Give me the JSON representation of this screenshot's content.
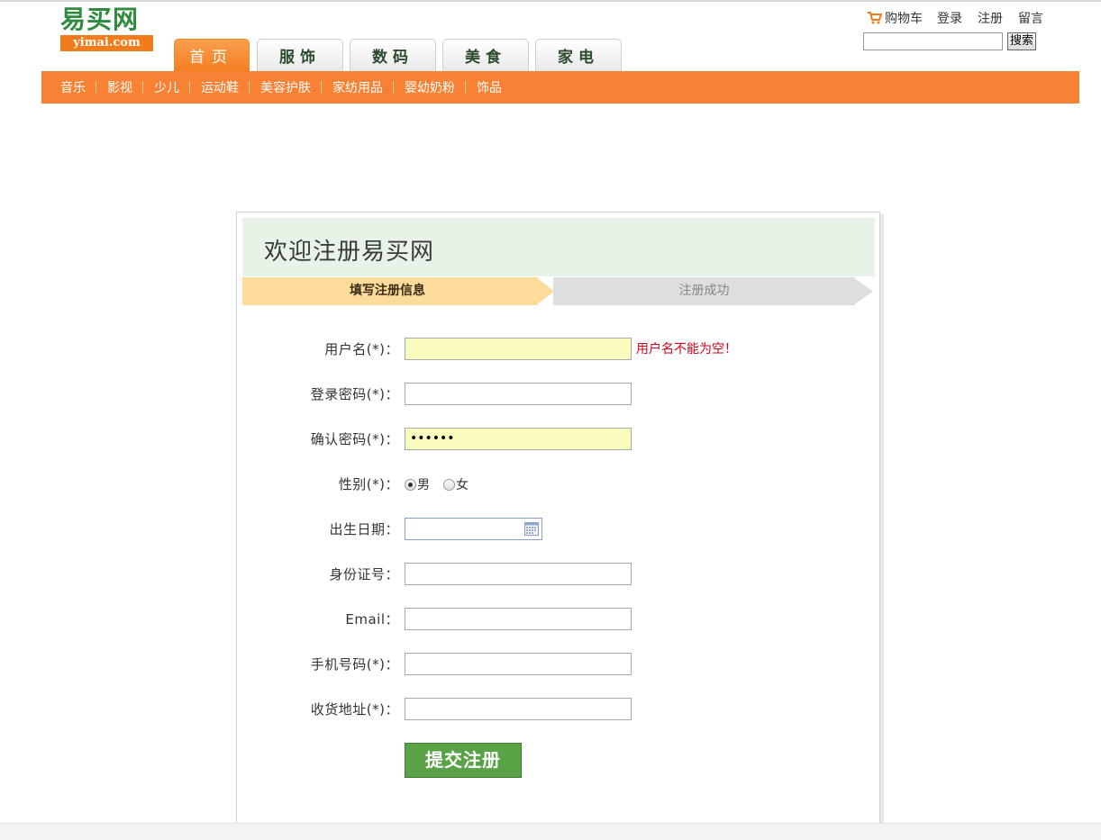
{
  "logo": {
    "cn": "易买网",
    "en": "yimai.com"
  },
  "top_links": {
    "cart": "购物车",
    "login": "登录",
    "register": "注册",
    "message": "留言"
  },
  "search": {
    "value": "",
    "button": "搜索"
  },
  "tabs": [
    {
      "label": "首页",
      "active": true
    },
    {
      "label": "服饰",
      "active": false
    },
    {
      "label": "数码",
      "active": false
    },
    {
      "label": "美食",
      "active": false
    },
    {
      "label": "家电",
      "active": false
    }
  ],
  "categories": [
    "音乐",
    "影视",
    "少儿",
    "运动鞋",
    "美容护肤",
    "家纺用品",
    "婴幼奶粉",
    "饰品"
  ],
  "form": {
    "title": "欢迎注册易买网",
    "steps": {
      "current": "填写注册信息",
      "next": "注册成功"
    },
    "username": {
      "label": "用户名(*)：",
      "value": "",
      "error": "用户名不能为空！"
    },
    "password": {
      "label": "登录密码(*)：",
      "value": ""
    },
    "confirm_password": {
      "label": "确认密码(*)：",
      "value": "••••••"
    },
    "gender": {
      "label": "性别(*)：",
      "options": [
        "男",
        "女"
      ],
      "selected": "男"
    },
    "birthday": {
      "label": "出生日期：",
      "value": ""
    },
    "id_number": {
      "label": "身份证号：",
      "value": ""
    },
    "email": {
      "label": "Email：",
      "value": ""
    },
    "mobile": {
      "label": "手机号码(*)：",
      "value": ""
    },
    "address": {
      "label": "收货地址(*)：",
      "value": ""
    },
    "submit": "提交注册"
  },
  "colors": {
    "orange": "#f98134",
    "green": "#5aa246",
    "error": "#d0021b",
    "step_active": "#fddb9a"
  }
}
